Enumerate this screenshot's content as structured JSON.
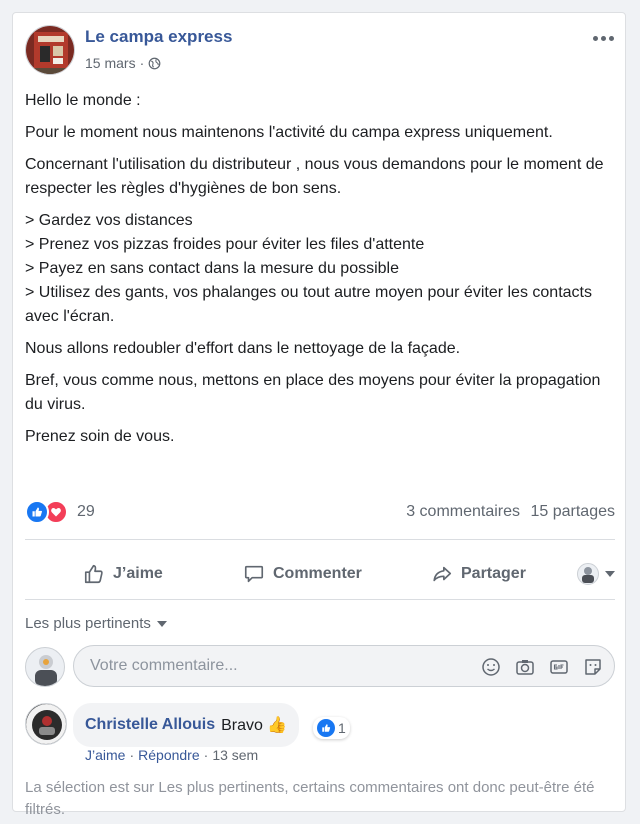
{
  "post": {
    "author": "Le campa express",
    "date": "15 mars",
    "date_sep": "·",
    "privacy_icon": "globe-icon",
    "body": [
      "Hello le monde :",
      "Pour le moment nous maintenons l'activité du campa express uniquement.",
      "Concernant l'utilisation du distributeur , nous vous demandons pour le moment de respecter les règles d'hygiènes de bon sens.",
      "> Gardez vos distances",
      "> Prenez vos pizzas froides pour éviter les files d'attente",
      "> Payez en sans contact dans la mesure du possible",
      "> Utilisez des gants, vos phalanges ou tout autre moyen pour éviter les contacts avec l'écran.",
      "Nous allons redoubler d'effort dans le nettoyage de la façade.",
      "Bref, vous comme nous, mettons en place des moyens pour éviter la propagation du virus.",
      "Prenez soin de vous."
    ]
  },
  "reactions": {
    "count": "29",
    "comments": "3 commentaires",
    "shares": "15 partages",
    "types": [
      "like-icon",
      "love-icon"
    ]
  },
  "actions": {
    "like": "J’aime",
    "comment": "Commenter",
    "share": "Partager"
  },
  "sort": {
    "label": "Les plus pertinents"
  },
  "composer": {
    "placeholder": "Votre commentaire...",
    "tools": [
      "emoji-icon",
      "camera-icon",
      "gif-icon",
      "sticker-icon"
    ]
  },
  "comment": {
    "author": "Christelle Allouis",
    "text": "Bravo 👍",
    "like_count": "1",
    "like_action": "J’aime",
    "reply_action": "Répondre",
    "sep": "·",
    "time": "13 sem"
  },
  "filter_note": "La sélection est sur Les plus pertinents, certains commentaires ont donc peut-être été filtrés.",
  "colors": {
    "link": "#385898",
    "like_blue": "#1877f2",
    "love_red": "#f33e58",
    "muted": "#606770"
  }
}
